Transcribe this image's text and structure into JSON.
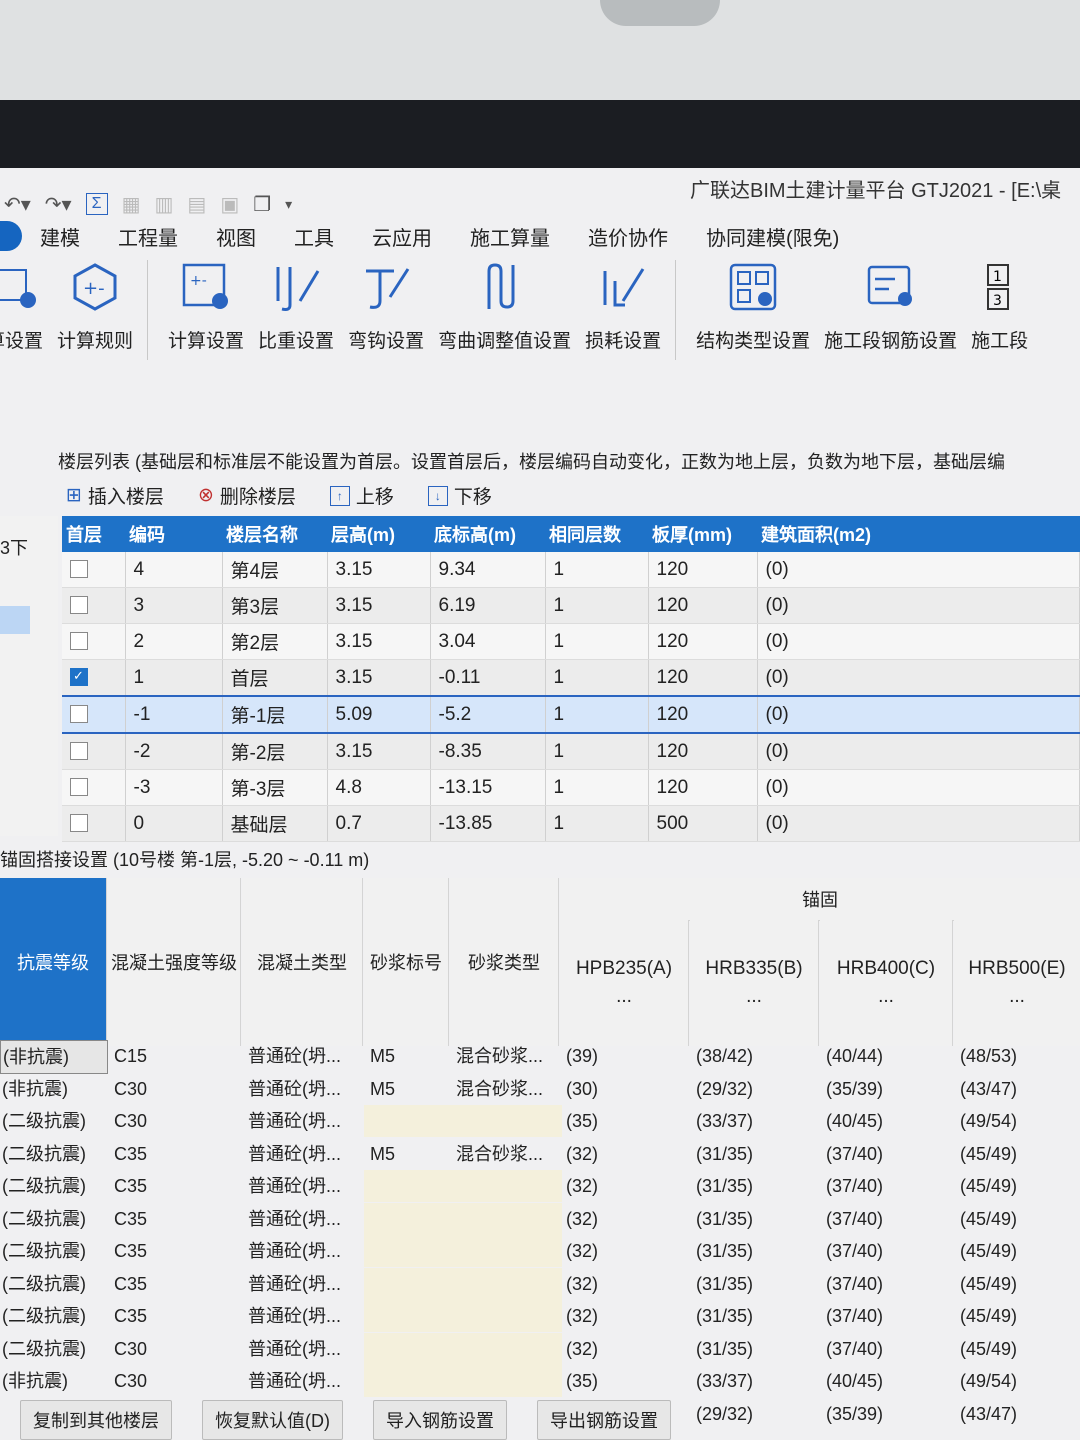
{
  "app_title": "广联达BIM土建计量平台 GTJ2021 - [E:\\桌",
  "menu": [
    "建模",
    "工程量",
    "视图",
    "工具",
    "云应用",
    "施工算量",
    "造价协作",
    "协同建模(限免)"
  ],
  "ribbon": [
    {
      "label": "算设置",
      "icon": "gear-icon"
    },
    {
      "label": "计算规则",
      "icon": "hexagon-calc-icon"
    },
    {
      "label": "计算设置",
      "icon": "calc-settings-icon"
    },
    {
      "label": "比重设置",
      "icon": "weight-icon"
    },
    {
      "label": "弯钩设置",
      "icon": "hook-icon"
    },
    {
      "label": "弯曲调整值设置",
      "icon": "bend-icon"
    },
    {
      "label": "损耗设置",
      "icon": "loss-icon"
    },
    {
      "label": "结构类型设置",
      "icon": "structure-icon"
    },
    {
      "label": "施工段钢筋设置",
      "icon": "segment-rebar-icon"
    },
    {
      "label": "施工段",
      "icon": "segment-icon"
    }
  ],
  "floor_list": {
    "hint": "楼层列表 (基础层和标准层不能设置为首层。设置首层后，楼层编码自动变化，正数为地上层，负数为地下层，基础层编",
    "toolbar": [
      "插入楼层",
      "删除楼层",
      "上移",
      "下移"
    ],
    "left_label": "3下",
    "columns": [
      "首层",
      "编码",
      "楼层名称",
      "层高(m)",
      "底标高(m)",
      "相同层数",
      "板厚(mm)",
      "建筑面积(m2)"
    ],
    "rows": [
      {
        "first": false,
        "code": "4",
        "name": "第4层",
        "height": "3.15",
        "bottom": "9.34",
        "same": "1",
        "thick": "120",
        "area": "(0)"
      },
      {
        "first": false,
        "code": "3",
        "name": "第3层",
        "height": "3.15",
        "bottom": "6.19",
        "same": "1",
        "thick": "120",
        "area": "(0)"
      },
      {
        "first": false,
        "code": "2",
        "name": "第2层",
        "height": "3.15",
        "bottom": "3.04",
        "same": "1",
        "thick": "120",
        "area": "(0)"
      },
      {
        "first": true,
        "code": "1",
        "name": "首层",
        "height": "3.15",
        "bottom": "-0.11",
        "same": "1",
        "thick": "120",
        "area": "(0)"
      },
      {
        "first": false,
        "code": "-1",
        "name": "第-1层",
        "height": "5.09",
        "bottom": "-5.2",
        "same": "1",
        "thick": "120",
        "area": "(0)",
        "selected": true
      },
      {
        "first": false,
        "code": "-2",
        "name": "第-2层",
        "height": "3.15",
        "bottom": "-8.35",
        "same": "1",
        "thick": "120",
        "area": "(0)"
      },
      {
        "first": false,
        "code": "-3",
        "name": "第-3层",
        "height": "4.8",
        "bottom": "-13.15",
        "same": "1",
        "thick": "120",
        "area": "(0)"
      },
      {
        "first": false,
        "code": "0",
        "name": "基础层",
        "height": "0.7",
        "bottom": "-13.85",
        "same": "1",
        "thick": "500",
        "area": "(0)"
      }
    ]
  },
  "anchor": {
    "title": "锚固搭接设置 (10号楼 第-1层, -5.20 ~ -0.11 m)",
    "group": "锚固",
    "headers": [
      "抗震等级",
      "混凝土强度等级",
      "混凝土类型",
      "砂浆标号",
      "砂浆类型"
    ],
    "rebar_headers": [
      "HPB235(A)",
      "HRB335(B)",
      "HRB400(C)",
      "HRB500(E)"
    ],
    "rebar_dots": "...",
    "rows": [
      [
        "(非抗震)",
        "C15",
        "普通砼(坍...",
        "M5",
        "混合砂浆...",
        "(39)",
        "(38/42)",
        "(40/44)",
        "(48/53)"
      ],
      [
        "(非抗震)",
        "C30",
        "普通砼(坍...",
        "M5",
        "混合砂浆...",
        "(30)",
        "(29/32)",
        "(35/39)",
        "(43/47)"
      ],
      [
        "(二级抗震)",
        "C30",
        "普通砼(坍...",
        "",
        "",
        "(35)",
        "(33/37)",
        "(40/45)",
        "(49/54)"
      ],
      [
        "(二级抗震)",
        "C35",
        "普通砼(坍...",
        "M5",
        "混合砂浆...",
        "(32)",
        "(31/35)",
        "(37/40)",
        "(45/49)"
      ],
      [
        "(二级抗震)",
        "C35",
        "普通砼(坍...",
        "",
        "",
        "(32)",
        "(31/35)",
        "(37/40)",
        "(45/49)"
      ],
      [
        "(二级抗震)",
        "C35",
        "普通砼(坍...",
        "",
        "",
        "(32)",
        "(31/35)",
        "(37/40)",
        "(45/49)"
      ],
      [
        "(二级抗震)",
        "C35",
        "普通砼(坍...",
        "",
        "",
        "(32)",
        "(31/35)",
        "(37/40)",
        "(45/49)"
      ],
      [
        "(二级抗震)",
        "C35",
        "普通砼(坍...",
        "",
        "",
        "(32)",
        "(31/35)",
        "(37/40)",
        "(45/49)"
      ],
      [
        "(二级抗震)",
        "C35",
        "普通砼(坍...",
        "",
        "",
        "(32)",
        "(31/35)",
        "(37/40)",
        "(45/49)"
      ],
      [
        "(二级抗震)",
        "C30",
        "普通砼(坍...",
        "",
        "",
        "(32)",
        "(31/35)",
        "(37/40)",
        "(45/49)"
      ],
      [
        "(非抗震)",
        "C30",
        "普通砼(坍...",
        "",
        "",
        "(35)",
        "(33/37)",
        "(40/45)",
        "(49/54)"
      ],
      [
        "",
        "",
        "",
        "",
        "",
        "(30)",
        "(29/32)",
        "(35/39)",
        "(43/47)"
      ]
    ]
  },
  "bottom_tabs": [
    "复制到其他楼层",
    "恢复默认值(D)",
    "导入钢筋设置",
    "导出钢筋设置"
  ],
  "colors": {
    "accent": "#1e72c8",
    "selection": "#d6e6fa"
  }
}
